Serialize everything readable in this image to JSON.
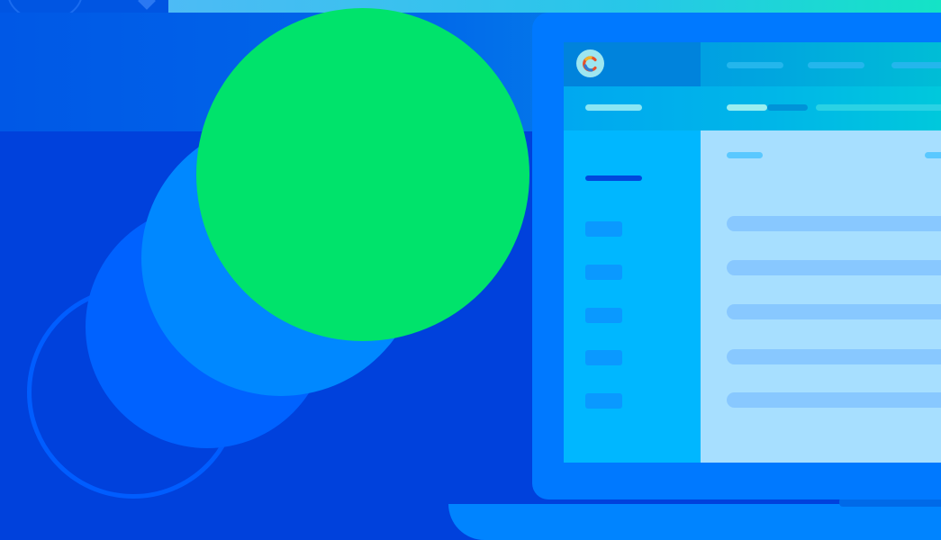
{
  "theme": {
    "background": "#0041dc",
    "accent_green": "#00e36b",
    "accent_blue": "#0088ff"
  },
  "illustration": {
    "icons": [
      "ring-shape",
      "circle-shape",
      "circle-shape",
      "circle-shape"
    ]
  },
  "laptop": {
    "screen": {
      "logo_letter": "C",
      "logo_icon": "brand-logo-icon",
      "nav_items": 3,
      "sidebar_items": 5,
      "content_rows": 5
    }
  }
}
